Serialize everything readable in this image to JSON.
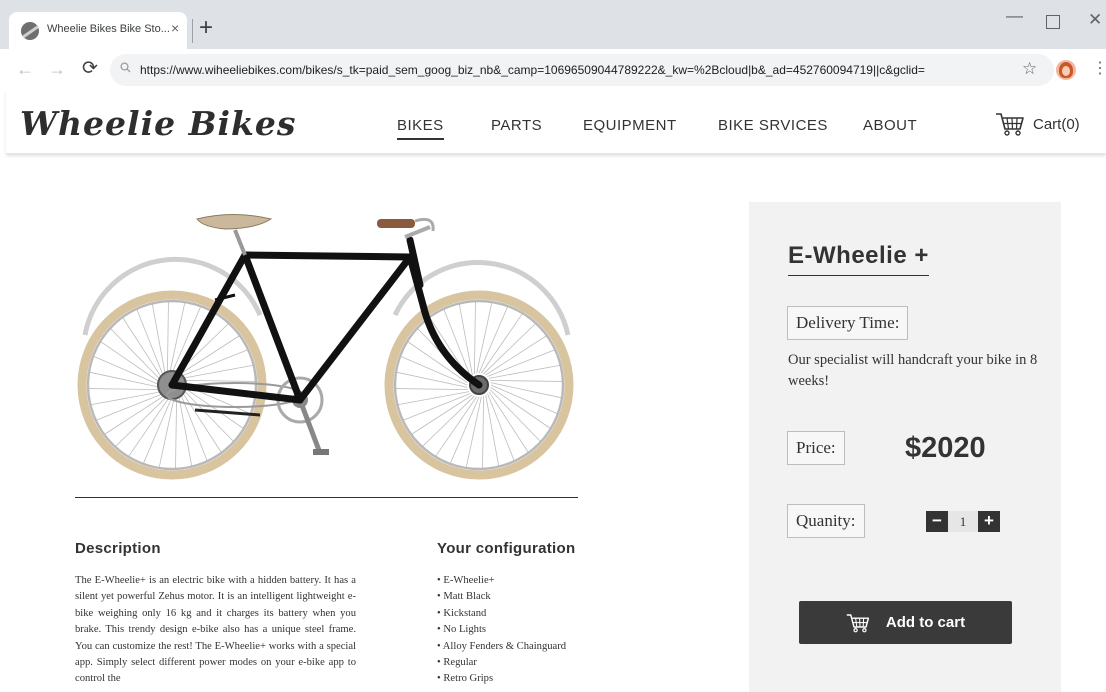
{
  "browser": {
    "tab_title": "Wheelie  Bikes Bike Sto...",
    "tab_close": "×",
    "new_tab": "+",
    "url": "https://www.wiheeliebikes.com/bikes/s_tk=paid_sem_goog_biz_nb&_camp=10696509044789222&_kw=%2Bcloud|b&_ad=452760094719||c&gclid=",
    "back": "←",
    "forward": "→",
    "reload": "⟳",
    "lock_icon": "🔍︎",
    "star": "☆",
    "menu": "⋮",
    "minimize": "—",
    "close": "✕"
  },
  "site": {
    "logo": "Wheelie Bikes",
    "nav": [
      {
        "label": "BIKES",
        "active": true
      },
      {
        "label": "PARTS"
      },
      {
        "label": "EQUIPMENT"
      },
      {
        "label": "BIKE SRVICES"
      },
      {
        "label": "ABOUT"
      }
    ],
    "cart_label": "Cart(0)"
  },
  "product": {
    "name": "E-Wheelie +",
    "delivery_label": "Delivery Time:",
    "delivery_text": "Our specialist will handcraft your bike in 8 weeks!",
    "price_label": "Price:",
    "price": "$2020",
    "quantity_label": "Quanity:",
    "quantity": "1",
    "minus": "−",
    "plus": "+",
    "add_to_cart": "Add to cart"
  },
  "description": {
    "heading": "Description",
    "text": "The E-Wheelie+ is an electric bike with a hidden battery. It has a silent yet powerful Zehus motor. It is an intelligent lightweight e-bike weighing only 16 kg and it charges its battery when you brake. This trendy design e-bike also has a unique steel frame. You can customize the rest! The E-Wheelie+ works with a special app. Simply select different power modes on your e-bike app to control the"
  },
  "configuration": {
    "heading": "Your configuration",
    "items": [
      "E-Wheelie+",
      "Matt Black",
      "Kickstand",
      "No Lights",
      "Alloy Fenders & Chainguard",
      "Regular",
      "Retro Grips"
    ]
  },
  "colors": {
    "dark": "#333333",
    "panel": "#f2f2f2",
    "tire": "#d9c4a0",
    "saddle": "#cbb89c",
    "grip": "#8a5a3c"
  }
}
